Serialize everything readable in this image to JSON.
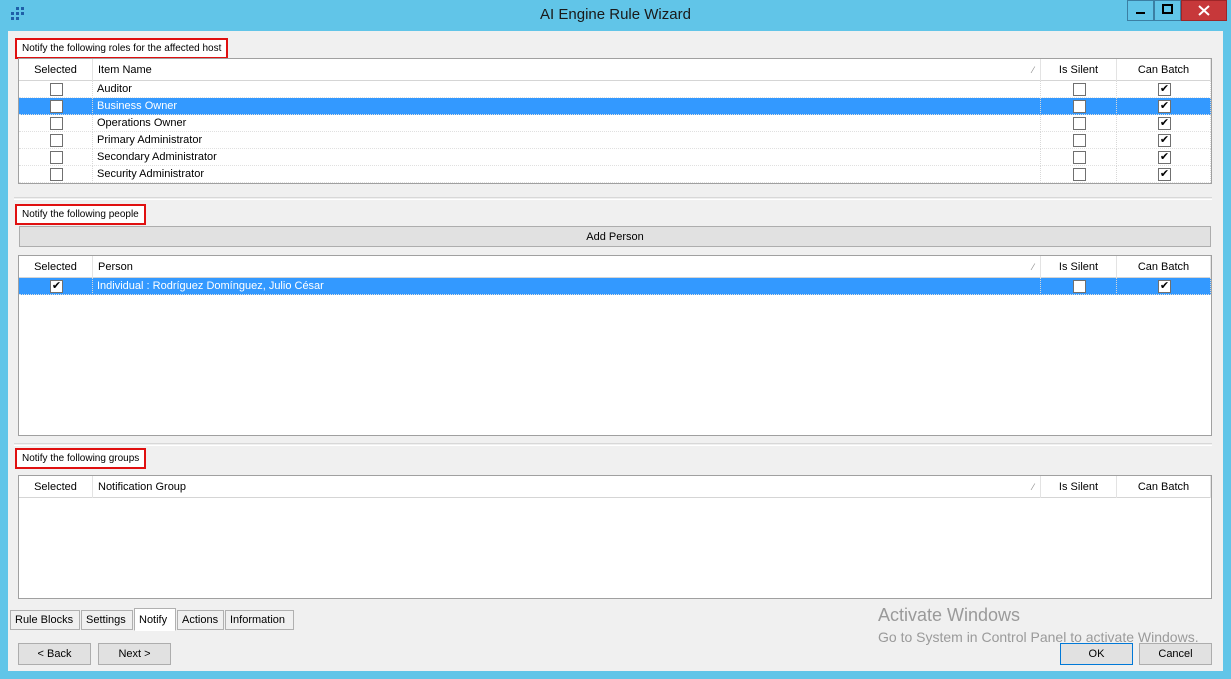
{
  "window": {
    "title": "AI Engine Rule Wizard",
    "icon": "app-dots-icon",
    "controls": [
      "minimize-icon",
      "maximize-icon",
      "close-icon"
    ]
  },
  "roles_section": {
    "label": "Notify the following roles for the affected host",
    "columns": [
      "Selected",
      "Item Name",
      "Is Silent",
      "Can Batch"
    ],
    "rows": [
      {
        "selected": false,
        "name": "Auditor",
        "is_silent": false,
        "can_batch": true,
        "highlighted": false
      },
      {
        "selected": false,
        "name": "Business Owner",
        "is_silent": false,
        "can_batch": true,
        "highlighted": true
      },
      {
        "selected": false,
        "name": "Operations Owner",
        "is_silent": false,
        "can_batch": true,
        "highlighted": false
      },
      {
        "selected": false,
        "name": "Primary Administrator",
        "is_silent": false,
        "can_batch": true,
        "highlighted": false
      },
      {
        "selected": false,
        "name": "Secondary Administrator",
        "is_silent": false,
        "can_batch": true,
        "highlighted": false
      },
      {
        "selected": false,
        "name": "Security Administrator",
        "is_silent": false,
        "can_batch": true,
        "highlighted": false
      }
    ]
  },
  "people_section": {
    "label": "Notify the following people",
    "add_button": "Add Person",
    "columns": [
      "Selected",
      "Person",
      "Is Silent",
      "Can Batch"
    ],
    "rows": [
      {
        "selected": true,
        "name": "Individual : Rodríguez Domínguez, Julio César",
        "is_silent": false,
        "can_batch": true,
        "highlighted": true
      }
    ]
  },
  "groups_section": {
    "label": "Notify the following groups",
    "columns": [
      "Selected",
      "Notification Group",
      "Is Silent",
      "Can Batch"
    ],
    "rows": []
  },
  "tabs": [
    {
      "label": "Rule Blocks",
      "active": false
    },
    {
      "label": "Settings",
      "active": false
    },
    {
      "label": "Notify",
      "active": true
    },
    {
      "label": "Actions",
      "active": false
    },
    {
      "label": "Information",
      "active": false
    }
  ],
  "buttons": {
    "back": "< Back",
    "next": "Next >",
    "ok": "OK",
    "cancel": "Cancel"
  },
  "watermark": {
    "line1": "Activate Windows",
    "line2": "Go to System in Control Panel to activate Windows."
  },
  "colors": {
    "title_bar": "#61c5e8",
    "selection": "#3399ff",
    "label_border": "#e01010"
  }
}
